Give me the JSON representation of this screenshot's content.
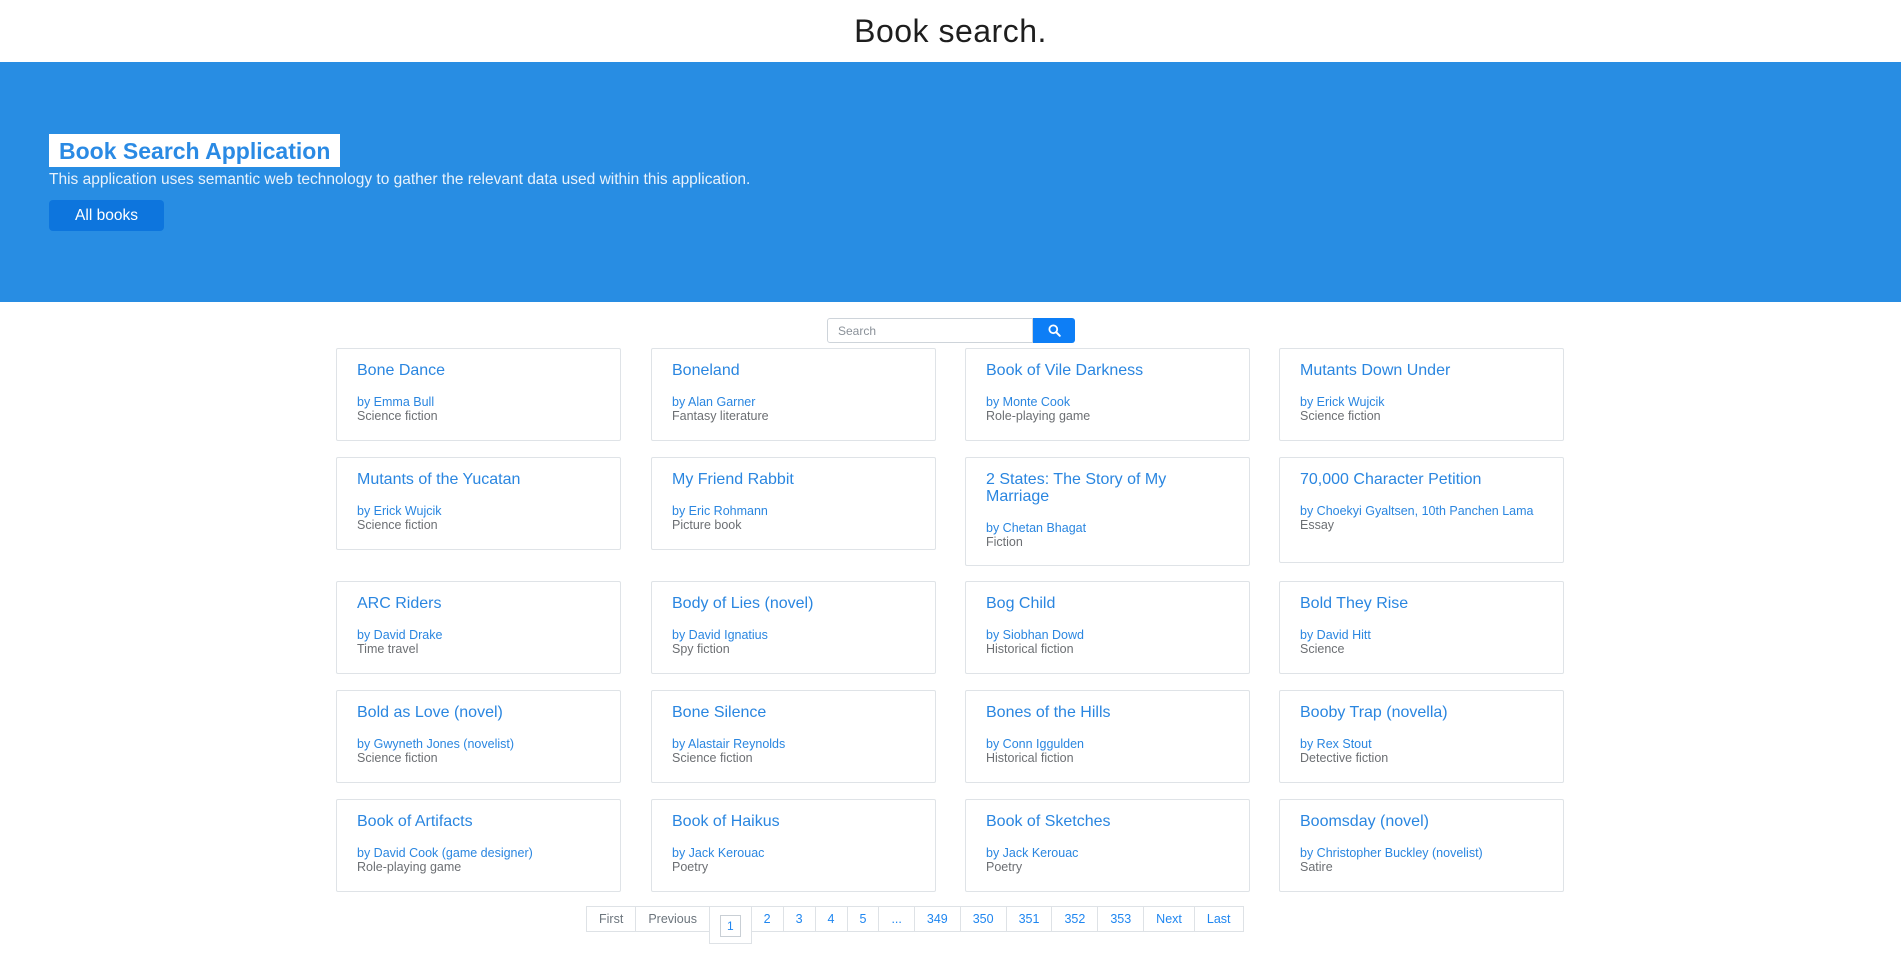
{
  "page": {
    "title": "Book search."
  },
  "hero": {
    "title": "Book Search Application",
    "description": "This application uses semantic web technology to gather the relevant data used within this application.",
    "button_label": "All books"
  },
  "search": {
    "placeholder": "Search",
    "icon": "search-icon"
  },
  "books": [
    {
      "title": "Bone Dance",
      "author": "by Emma Bull",
      "genre": "Science fiction"
    },
    {
      "title": "Boneland",
      "author": "by Alan Garner",
      "genre": "Fantasy literature"
    },
    {
      "title": "Book of Vile Darkness",
      "author": "by Monte Cook",
      "genre": "Role-playing game"
    },
    {
      "title": "Mutants Down Under",
      "author": "by Erick Wujcik",
      "genre": "Science fiction"
    },
    {
      "title": "Mutants of the Yucatan",
      "author": "by Erick Wujcik",
      "genre": "Science fiction"
    },
    {
      "title": "My Friend Rabbit",
      "author": "by Eric Rohmann",
      "genre": "Picture book"
    },
    {
      "title": "2 States: The Story of My Marriage",
      "author": "by Chetan Bhagat",
      "genre": "Fiction"
    },
    {
      "title": "70,000 Character Petition",
      "author": "by Choekyi Gyaltsen, 10th Panchen Lama",
      "genre": "Essay"
    },
    {
      "title": "ARC Riders",
      "author": "by David Drake",
      "genre": "Time travel"
    },
    {
      "title": "Body of Lies (novel)",
      "author": "by David Ignatius",
      "genre": "Spy fiction"
    },
    {
      "title": "Bog Child",
      "author": "by Siobhan Dowd",
      "genre": "Historical fiction"
    },
    {
      "title": "Bold They Rise",
      "author": "by David Hitt",
      "genre": "Science"
    },
    {
      "title": "Bold as Love (novel)",
      "author": "by Gwyneth Jones (novelist)",
      "genre": "Science fiction"
    },
    {
      "title": "Bone Silence",
      "author": "by Alastair Reynolds",
      "genre": "Science fiction"
    },
    {
      "title": "Bones of the Hills",
      "author": "by Conn Iggulden",
      "genre": "Historical fiction"
    },
    {
      "title": "Booby Trap (novella)",
      "author": "by Rex Stout",
      "genre": "Detective fiction"
    },
    {
      "title": "Book of Artifacts",
      "author": "by David Cook (game designer)",
      "genre": "Role-playing game"
    },
    {
      "title": "Book of Haikus",
      "author": "by Jack Kerouac",
      "genre": "Poetry"
    },
    {
      "title": "Book of Sketches",
      "author": "by Jack Kerouac",
      "genre": "Poetry"
    },
    {
      "title": "Boomsday (novel)",
      "author": "by Christopher Buckley (novelist)",
      "genre": "Satire"
    }
  ],
  "pagination": {
    "first": "First",
    "previous": "Previous",
    "current": "1",
    "pages": [
      "2",
      "3",
      "4",
      "5",
      "...",
      "349",
      "350",
      "351",
      "352",
      "353"
    ],
    "next": "Next",
    "last": "Last"
  }
}
